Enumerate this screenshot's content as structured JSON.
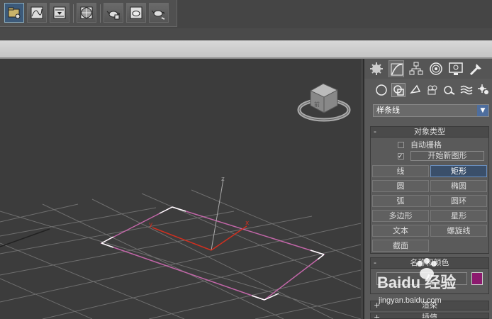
{
  "toolbar": {
    "buttons": [
      {
        "name": "project-folder-button",
        "icon": "folder-icon"
      },
      {
        "name": "track-view-button",
        "icon": "curve-editor-icon"
      },
      {
        "name": "render-setup-button",
        "icon": "render-setup-icon"
      },
      {
        "name": "material-editor-button",
        "icon": "material-editor-icon"
      },
      {
        "name": "render-frame-button",
        "icon": "teapot-frame-icon"
      },
      {
        "name": "rendered-frame-window-button",
        "icon": "teapot-window-icon"
      },
      {
        "name": "render-production-button",
        "icon": "teapot-render-icon"
      }
    ]
  },
  "viewport": {
    "axis_x": "x",
    "axis_y": "y",
    "axis_z": "z",
    "grid_color": "#7a7a7a",
    "shape_color": "#c060a0",
    "gizmo_color": "#d03020"
  },
  "command_panel": {
    "tabs": [
      "create-tab",
      "modify-tab",
      "hierarchy-tab",
      "motion-tab",
      "display-tab",
      "utilities-tab"
    ],
    "categories": [
      "geometry-icon",
      "shapes-icon",
      "lights-icon",
      "cameras-icon",
      "helpers-icon",
      "space-warps-icon",
      "systems-icon"
    ],
    "shape_type_dropdown": "样条线",
    "object_type": {
      "title": "对象类型",
      "sign": "-",
      "auto_grid": "自动栅格",
      "start_new_shape": "开始新图形",
      "buttons": [
        {
          "label": "线",
          "active": false
        },
        {
          "label": "矩形",
          "active": true
        },
        {
          "label": "圆",
          "active": false
        },
        {
          "label": "椭圆",
          "active": false
        },
        {
          "label": "弧",
          "active": false
        },
        {
          "label": "圆环",
          "active": false
        },
        {
          "label": "多边形",
          "active": false
        },
        {
          "label": "星形",
          "active": false
        },
        {
          "label": "文本",
          "active": false
        },
        {
          "label": "螺旋线",
          "active": false
        },
        {
          "label": "截面",
          "active": false
        }
      ]
    },
    "name_color": {
      "title": "名称和颜色",
      "sign": "-",
      "swatch_color": "#8c1a6e"
    },
    "rendering": {
      "title": "渲染",
      "sign": "+"
    },
    "interpolation": {
      "title": "插值",
      "sign": "+"
    }
  },
  "watermark": {
    "logo": "Baidu 经验",
    "url": "jingyan.baidu.com"
  }
}
